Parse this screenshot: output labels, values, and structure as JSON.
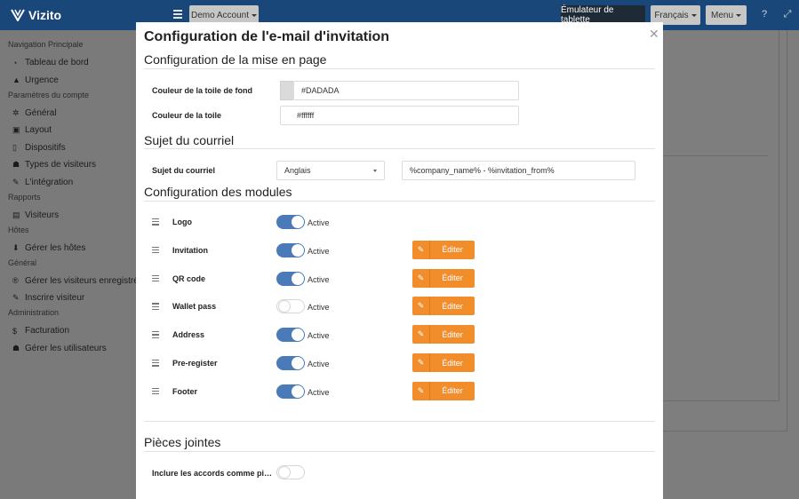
{
  "brand": {
    "name": "Vizito"
  },
  "topbar": {
    "account_label": "Demo Account",
    "tablet_emulator_label": "Émulateur de tablette",
    "language_label": "Français",
    "menu_label": "Menu",
    "help_icon": "?",
    "expand_icon": "⤢"
  },
  "sidebar": {
    "sections": [
      {
        "heading": "Navigation Principale",
        "items": [
          {
            "label": "Tableau de bord",
            "icon": "dashboard-icon"
          },
          {
            "label": "Urgence",
            "icon": "warning-icon"
          }
        ]
      },
      {
        "heading": "Paramètres du compte",
        "items": [
          {
            "label": "Général",
            "icon": "gear-icon"
          },
          {
            "label": "Layout",
            "icon": "image-icon"
          },
          {
            "label": "Dispositifs",
            "icon": "tablet-icon"
          },
          {
            "label": "Types de visiteurs",
            "icon": "users-icon"
          },
          {
            "label": "L'intégration",
            "icon": "pencil-icon"
          }
        ]
      },
      {
        "heading": "Rapports",
        "items": [
          {
            "label": "Visiteurs",
            "icon": "book-icon"
          }
        ]
      },
      {
        "heading": "Hôtes",
        "items": [
          {
            "label": "Gérer les hôtes",
            "icon": "download-icon"
          }
        ]
      },
      {
        "heading": "Général",
        "items": [
          {
            "label": "Gérer les visiteurs enregistrés",
            "icon": "registered-icon"
          },
          {
            "label": "Inscrire visiteur",
            "icon": "pencil-icon"
          }
        ]
      },
      {
        "heading": "Administration",
        "items": [
          {
            "label": "Facturation",
            "icon": "dollar-icon"
          },
          {
            "label": "Gérer les utilisateurs",
            "icon": "user-cog-icon"
          }
        ]
      }
    ]
  },
  "modal": {
    "title": "Configuration de l'e-mail d'invitation",
    "layout_section": {
      "title": "Configuration de la mise en page",
      "bg_color_label": "Couleur de la toile de fond",
      "bg_color_value": "#DADADA",
      "canvas_color_label": "Couleur de la toile",
      "canvas_color_value": "#ffffff"
    },
    "subject_section": {
      "title": "Sujet du courriel",
      "field_label": "Sujet du courriel",
      "language_selected": "Anglais",
      "subject_value": "%company_name% - %invitation_from%"
    },
    "modules_section": {
      "title": "Configuration des modules",
      "active_label": "Active",
      "edit_label": "Éditer",
      "modules": [
        {
          "name": "Logo",
          "active": true,
          "editable": false
        },
        {
          "name": "Invitation",
          "active": true,
          "editable": true
        },
        {
          "name": "QR code",
          "active": true,
          "editable": true
        },
        {
          "name": "Wallet pass",
          "active": false,
          "editable": true
        },
        {
          "name": "Address",
          "active": true,
          "editable": true
        },
        {
          "name": "Pre-register",
          "active": true,
          "editable": true
        },
        {
          "name": "Footer",
          "active": true,
          "editable": true
        }
      ]
    },
    "attachments_section": {
      "title": "Pièces jointes",
      "agreements_label": "Inclure les accords comme pi…",
      "agreements_active": false
    }
  },
  "colors": {
    "navbar": "#19477a",
    "accent_orange": "#f28d2c",
    "toggle_on": "#4a7ab8",
    "swatch": "#DADADA"
  }
}
